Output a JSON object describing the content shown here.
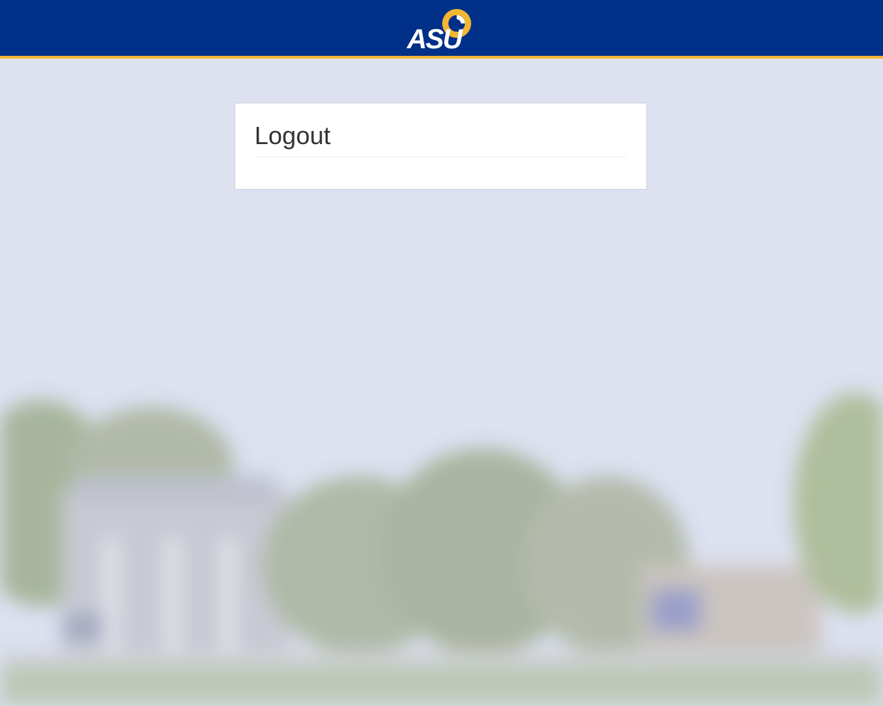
{
  "header": {
    "logo_alt": "ASU",
    "colors": {
      "brand_blue": "#003087",
      "brand_gold": "#f2b632"
    }
  },
  "card": {
    "title": "Logout"
  },
  "background": {
    "description_icon": "campus-photo-blurred"
  }
}
